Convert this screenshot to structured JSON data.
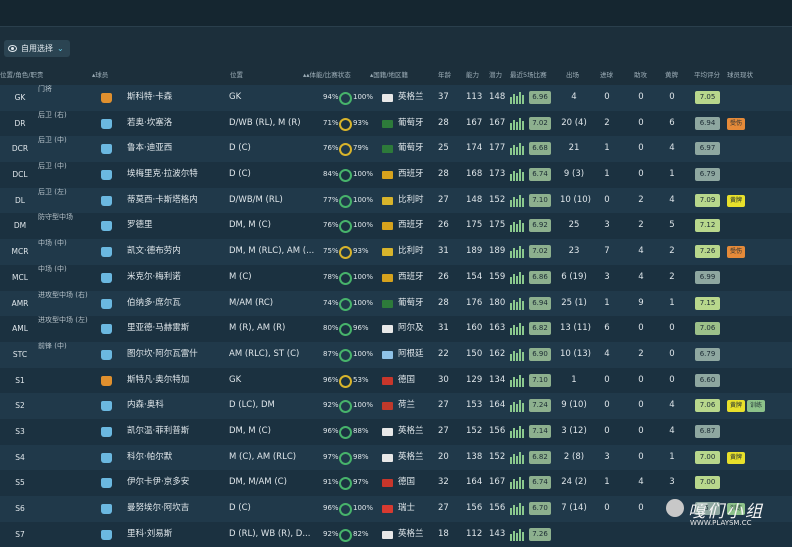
{
  "filter": {
    "label": "自用选择"
  },
  "headers": {
    "pos": "位置/角色/职责",
    "player": "球员",
    "position": "位置",
    "condition": "体能/比赛状态",
    "nation": "国籍/地区籍",
    "age": "年龄",
    "ca": "能力",
    "pa": "潜力",
    "form": "最近5场比赛",
    "apps": "出场",
    "goals": "进球",
    "assists": "助攻",
    "yellow": "黄牌",
    "rating": "平均评分",
    "status": "球员现状"
  },
  "colors": {
    "bg": "#1c2f3b",
    "accent": "#67c8e0",
    "ring_good": "#47b36b",
    "ring_warn": "#d8b42b"
  },
  "rows": [
    {
      "pos": "GK",
      "role": "门将",
      "kit": "gk",
      "name": "斯科特·卡森",
      "position": "GK",
      "cond": "94%",
      "fit": "100%",
      "nat": "英格兰",
      "age": "37",
      "ca": "113",
      "pa": "148",
      "form": "6.96",
      "apps": "4",
      "goals": "0",
      "assists": "0",
      "yellow": "0",
      "rating": "7.05",
      "rc": "r-hi",
      "tags": []
    },
    {
      "pos": "DR",
      "role": "后卫 (右)",
      "kit": "out",
      "name": "若奥·坎塞洛",
      "position": "D/WB (RL), M (R)",
      "cond": "71%",
      "fit": "93%",
      "fy": true,
      "nat": "葡萄牙",
      "age": "28",
      "ca": "167",
      "pa": "167",
      "form": "7.02",
      "apps": "20 (4)",
      "goals": "2",
      "assists": "0",
      "yellow": "6",
      "rating": "6.94",
      "rc": "r-lo",
      "tags": [
        {
          "t": "受伤",
          "c": "orange"
        }
      ]
    },
    {
      "pos": "DCR",
      "role": "后卫 (中)",
      "kit": "out",
      "name": "鲁本·迪亚西",
      "position": "D (C)",
      "cond": "76%",
      "fit": "79%",
      "fy": true,
      "nat": "葡萄牙",
      "age": "25",
      "ca": "174",
      "pa": "177",
      "form": "6.68",
      "apps": "21",
      "goals": "1",
      "assists": "0",
      "yellow": "4",
      "rating": "6.97",
      "rc": "r-lo",
      "tags": []
    },
    {
      "pos": "DCL",
      "role": "后卫 (中)",
      "kit": "out",
      "name": "埃梅里克·拉波尔特",
      "position": "D (C)",
      "cond": "84%",
      "fit": "100%",
      "nat": "西班牙",
      "age": "28",
      "ca": "168",
      "pa": "173",
      "form": "6.74",
      "apps": "9 (3)",
      "goals": "1",
      "assists": "0",
      "yellow": "1",
      "rating": "6.79",
      "rc": "r-lo",
      "tags": []
    },
    {
      "pos": "DL",
      "role": "后卫 (左)",
      "kit": "out",
      "name": "蒂莫西·卡斯塔格内",
      "position": "D/WB/M (RL)",
      "cond": "77%",
      "fit": "100%",
      "nat": "比利时",
      "age": "27",
      "ca": "148",
      "pa": "152",
      "form": "7.10",
      "apps": "10 (10)",
      "goals": "0",
      "assists": "2",
      "yellow": "4",
      "rating": "7.09",
      "rc": "r-hi",
      "tags": [
        {
          "t": "黄牌",
          "c": "yellow"
        }
      ]
    },
    {
      "pos": "DM",
      "role": "防守型中场",
      "kit": "out",
      "name": "罗德里",
      "position": "DM, M (C)",
      "cond": "76%",
      "fit": "100%",
      "nat": "西班牙",
      "age": "26",
      "ca": "175",
      "pa": "175",
      "form": "6.92",
      "apps": "25",
      "goals": "3",
      "assists": "2",
      "yellow": "5",
      "rating": "7.12",
      "rc": "r-hi",
      "tags": []
    },
    {
      "pos": "MCR",
      "role": "中场 (中)",
      "kit": "out",
      "name": "凯文·德布劳内",
      "position": "DM, M (RLC), AM (...",
      "cond": "75%",
      "fit": "93%",
      "fy": true,
      "nat": "比利时",
      "age": "31",
      "ca": "189",
      "pa": "189",
      "form": "7.02",
      "apps": "23",
      "goals": "7",
      "assists": "4",
      "yellow": "2",
      "rating": "7.26",
      "rc": "r-hi",
      "tags": [
        {
          "t": "受伤",
          "c": "orange"
        }
      ]
    },
    {
      "pos": "MCL",
      "role": "中场 (中)",
      "kit": "out",
      "name": "米克尔·梅利诺",
      "position": "M (C)",
      "cond": "78%",
      "fit": "100%",
      "nat": "西班牙",
      "age": "26",
      "ca": "154",
      "pa": "159",
      "form": "6.86",
      "apps": "6 (19)",
      "goals": "3",
      "assists": "4",
      "yellow": "2",
      "rating": "6.99",
      "rc": "r-lo",
      "tags": []
    },
    {
      "pos": "AMR",
      "role": "进攻型中场 (右)",
      "kit": "out",
      "name": "伯纳多·席尔瓦",
      "position": "M/AM (RC)",
      "cond": "74%",
      "fit": "100%",
      "nat": "葡萄牙",
      "age": "28",
      "ca": "176",
      "pa": "180",
      "form": "6.94",
      "apps": "25 (1)",
      "goals": "1",
      "assists": "9",
      "yellow": "1",
      "rating": "7.15",
      "rc": "r-hi",
      "tags": []
    },
    {
      "pos": "AML",
      "role": "进攻型中场 (左)",
      "kit": "out",
      "name": "里亚德·马赫雷斯",
      "position": "M (R), AM (R)",
      "cond": "80%",
      "fit": "96%",
      "nat": "阿尔及",
      "age": "31",
      "ca": "160",
      "pa": "163",
      "form": "6.82",
      "apps": "13 (11)",
      "goals": "6",
      "assists": "0",
      "yellow": "0",
      "rating": "7.06",
      "rc": "r-mid",
      "tags": []
    },
    {
      "pos": "STC",
      "role": "前锋 (中)",
      "kit": "out",
      "name": "图尔坎·阿尔瓦雷什",
      "position": "AM (RLC), ST (C)",
      "cond": "87%",
      "fit": "100%",
      "nat": "阿根廷",
      "age": "22",
      "ca": "150",
      "pa": "162",
      "form": "6.90",
      "apps": "10 (13)",
      "goals": "4",
      "assists": "2",
      "yellow": "0",
      "rating": "6.79",
      "rc": "r-lo",
      "tags": []
    },
    {
      "pos": "S1",
      "role": "",
      "kit": "gk",
      "name": "斯特凡·奥尔特加",
      "position": "GK",
      "cond": "96%",
      "fit": "53%",
      "fy": true,
      "nat": "德国",
      "age": "30",
      "ca": "129",
      "pa": "134",
      "form": "7.10",
      "apps": "1",
      "goals": "0",
      "assists": "0",
      "yellow": "0",
      "rating": "6.60",
      "rc": "r-lo",
      "tags": []
    },
    {
      "pos": "S2",
      "role": "",
      "kit": "out",
      "name": "内森·奥科",
      "position": "D (LC), DM",
      "cond": "92%",
      "fit": "100%",
      "nat": "荷兰",
      "age": "27",
      "ca": "153",
      "pa": "164",
      "form": "7.24",
      "apps": "9 (10)",
      "goals": "0",
      "assists": "0",
      "yellow": "4",
      "rating": "7.06",
      "rc": "r-hi",
      "tags": [
        {
          "t": "黄牌",
          "c": "yellow"
        },
        {
          "t": "训练",
          "c": "green"
        }
      ]
    },
    {
      "pos": "S3",
      "role": "",
      "kit": "out",
      "name": "凯尔温·菲利普斯",
      "position": "DM, M (C)",
      "cond": "96%",
      "fit": "88%",
      "nat": "英格兰",
      "age": "27",
      "ca": "152",
      "pa": "156",
      "form": "7.14",
      "apps": "3 (12)",
      "goals": "0",
      "assists": "0",
      "yellow": "4",
      "rating": "6.87",
      "rc": "r-lo",
      "tags": []
    },
    {
      "pos": "S4",
      "role": "",
      "kit": "out",
      "name": "科尔·帕尔默",
      "position": "M (C), AM (RLC)",
      "cond": "97%",
      "fit": "98%",
      "nat": "英格兰",
      "age": "20",
      "ca": "138",
      "pa": "152",
      "form": "6.82",
      "apps": "2 (8)",
      "goals": "3",
      "assists": "0",
      "yellow": "1",
      "rating": "7.00",
      "rc": "r-hi",
      "tags": [
        {
          "t": "黄牌",
          "c": "yellow"
        }
      ]
    },
    {
      "pos": "S5",
      "role": "",
      "kit": "out",
      "name": "伊尔卡伊·京多安",
      "position": "DM, M/AM (C)",
      "cond": "91%",
      "fit": "97%",
      "nat": "德国",
      "age": "32",
      "ca": "164",
      "pa": "167",
      "form": "6.74",
      "apps": "24 (2)",
      "goals": "1",
      "assists": "4",
      "yellow": "3",
      "rating": "7.00",
      "rc": "r-hi",
      "tags": []
    },
    {
      "pos": "S6",
      "role": "",
      "kit": "out",
      "name": "曼努埃尔·阿坎吉",
      "position": "D (C)",
      "cond": "96%",
      "fit": "100%",
      "nat": "瑞士",
      "age": "27",
      "ca": "156",
      "pa": "156",
      "form": "6.70",
      "apps": "7 (14)",
      "goals": "0",
      "assists": "0",
      "yellow": "0",
      "rating": "6.",
      "rc": "r-lo",
      "tags": [
        {
          "t": "训练",
          "c": "green"
        }
      ]
    },
    {
      "pos": "S7",
      "role": "",
      "kit": "out",
      "name": "里科·刘易斯",
      "position": "D (RL), WB (R), D...",
      "cond": "92%",
      "fit": "82%",
      "nat": "英格兰",
      "age": "18",
      "ca": "112",
      "pa": "143",
      "form": "7.26",
      "apps": "",
      "goals": "",
      "assists": "",
      "yellow": "",
      "rating": "",
      "rc": "r-lo",
      "tags": []
    }
  ],
  "watermark": {
    "logo_text": "嘎们小组",
    "url": "WWW.PLAYSM.CC"
  }
}
